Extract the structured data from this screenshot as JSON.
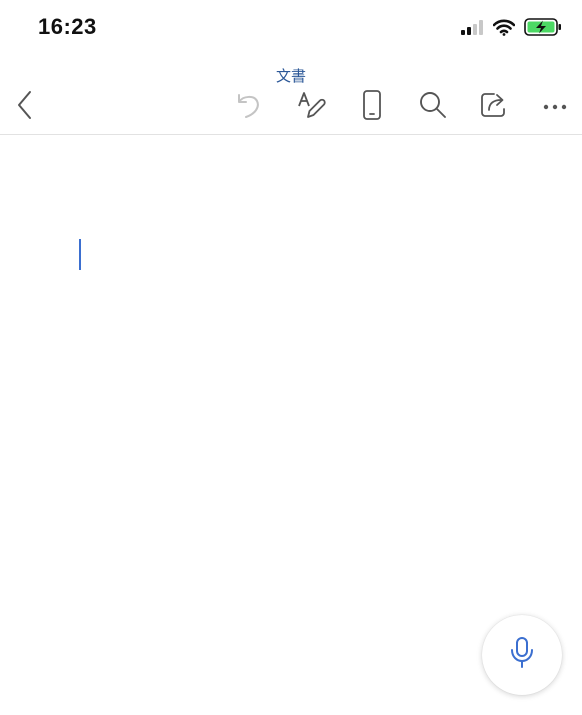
{
  "status_bar": {
    "time": "16:23",
    "icons": [
      "cellular-signal-icon",
      "wifi-icon",
      "battery-charging-icon"
    ]
  },
  "toolbar": {
    "title": "文書",
    "buttons": [
      "back-chevron-icon",
      "undo-icon",
      "text-format-icon",
      "mobile-view-icon",
      "search-icon",
      "share-icon",
      "more-icon"
    ]
  },
  "document": {
    "content": ""
  },
  "fab": {
    "icon": "microphone-icon"
  },
  "colors": {
    "accent": "#3b6fd0",
    "title": "#2b5797",
    "icon_gray": "#555555",
    "undo_disabled": "#c4c4c4",
    "battery_green": "#4cd964"
  }
}
